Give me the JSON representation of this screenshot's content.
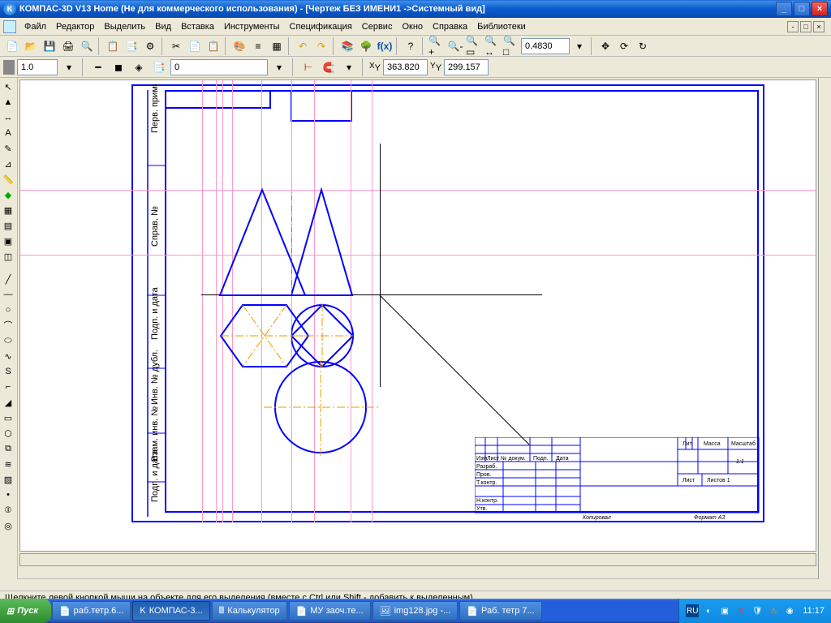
{
  "window": {
    "title": "КОМПАС-3D V13 Home (Не для коммерческого использования) - [Чертеж БЕЗ ИМЕНИ1 ->Системный вид]"
  },
  "menu": {
    "file": "Файл",
    "editor": "Редактор",
    "select": "Выделить",
    "view": "Вид",
    "insert": "Вставка",
    "tools": "Инструменты",
    "spec": "Спецификация",
    "service": "Сервис",
    "window": "Окно",
    "help": "Справка",
    "libraries": "Библиотеки"
  },
  "toolbar2": {
    "zoom": "0.4830",
    "coord_x": "363.820",
    "coord_y": "299.157"
  },
  "props": {
    "scale": "1.0",
    "layer": "0"
  },
  "status": "Щелкните левой кнопкой мыши на объекте для его выделения (вместе с Ctrl или Shift - добавить к выделенным)",
  "title_block": {
    "r1": "Изм",
    "r2": "Лист",
    "r3": "№ докум.",
    "r4": "Подп.",
    "r5": "Дата",
    "row_razrab": "Разраб.",
    "row_prov": "Пров.",
    "row_tkontr": "Т.контр.",
    "row_nkontr": "Н.контр.",
    "row_utw": "Утв.",
    "lit": "Лит.",
    "massa": "Масса",
    "masshtab": "Масштаб",
    "scale_val": "1:1",
    "list": "Лист",
    "listov": "Листов  1",
    "kopirov": "Копировал",
    "format": "Формат   A3"
  },
  "taskbar": {
    "start": "Пуск",
    "t1": "раб.тетр.6...",
    "t2": "КОМПАС-3...",
    "t3": "Калькулятор",
    "t4": "МУ заоч.те...",
    "t5": "img128.jpg -...",
    "t6": "Раб. тетр 7...",
    "clock": "11:17",
    "lang": "RU"
  }
}
